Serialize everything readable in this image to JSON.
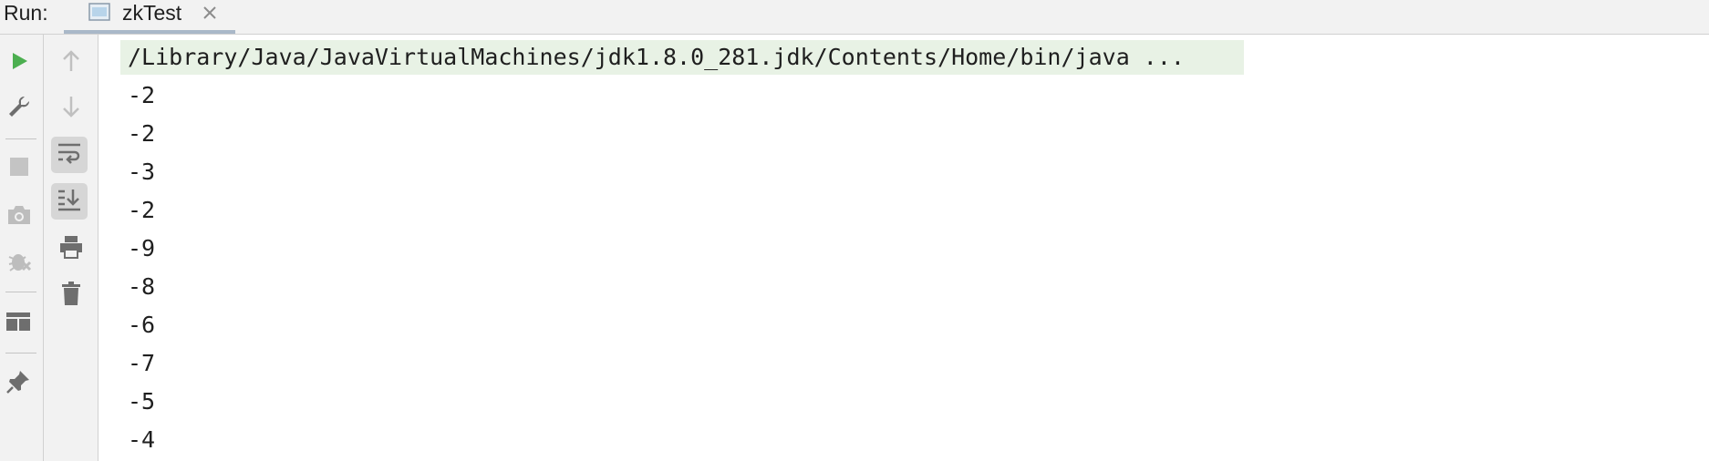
{
  "header": {
    "run_label": "Run:",
    "tab": {
      "label": "zkTest",
      "icon": "run-config-icon",
      "close_icon": "close-icon"
    }
  },
  "toolbar_left": {
    "items": [
      {
        "name": "rerun-button",
        "icon": "play-icon"
      },
      {
        "name": "edit-config-button",
        "icon": "wrench-icon"
      },
      {
        "name": "stop-button",
        "icon": "stop-icon"
      },
      {
        "name": "thread-dump-button",
        "icon": "camera-icon"
      },
      {
        "name": "debug-button",
        "icon": "bug-icon"
      },
      {
        "name": "layout-button",
        "icon": "layout-icon"
      },
      {
        "name": "pin-tab-button",
        "icon": "pin-icon"
      }
    ]
  },
  "toolbar_second": {
    "items": [
      {
        "name": "up-button",
        "icon": "arrow-up-icon"
      },
      {
        "name": "down-button",
        "icon": "arrow-down-icon"
      },
      {
        "name": "soft-wrap-button",
        "icon": "soft-wrap-icon",
        "active": true
      },
      {
        "name": "scroll-to-end-button",
        "icon": "scroll-to-end-icon",
        "active": true
      },
      {
        "name": "print-button",
        "icon": "printer-icon"
      },
      {
        "name": "clear-button",
        "icon": "trash-icon"
      }
    ]
  },
  "console": {
    "command": "/Library/Java/JavaVirtualMachines/jdk1.8.0_281.jdk/Contents/Home/bin/java ...",
    "lines": [
      "-2",
      "-2",
      "-3",
      "-2",
      "-9",
      "-8",
      "-6",
      "-7",
      "-5",
      "-4"
    ]
  },
  "colors": {
    "toolbar_bg": "#f2f2f2",
    "command_highlight": "#e8f2e5",
    "run_green": "#4caf50",
    "icon_gray": "#6e6e6e",
    "disabled_gray": "#b9b9b9",
    "tab_underline": "#a9b8c8"
  }
}
